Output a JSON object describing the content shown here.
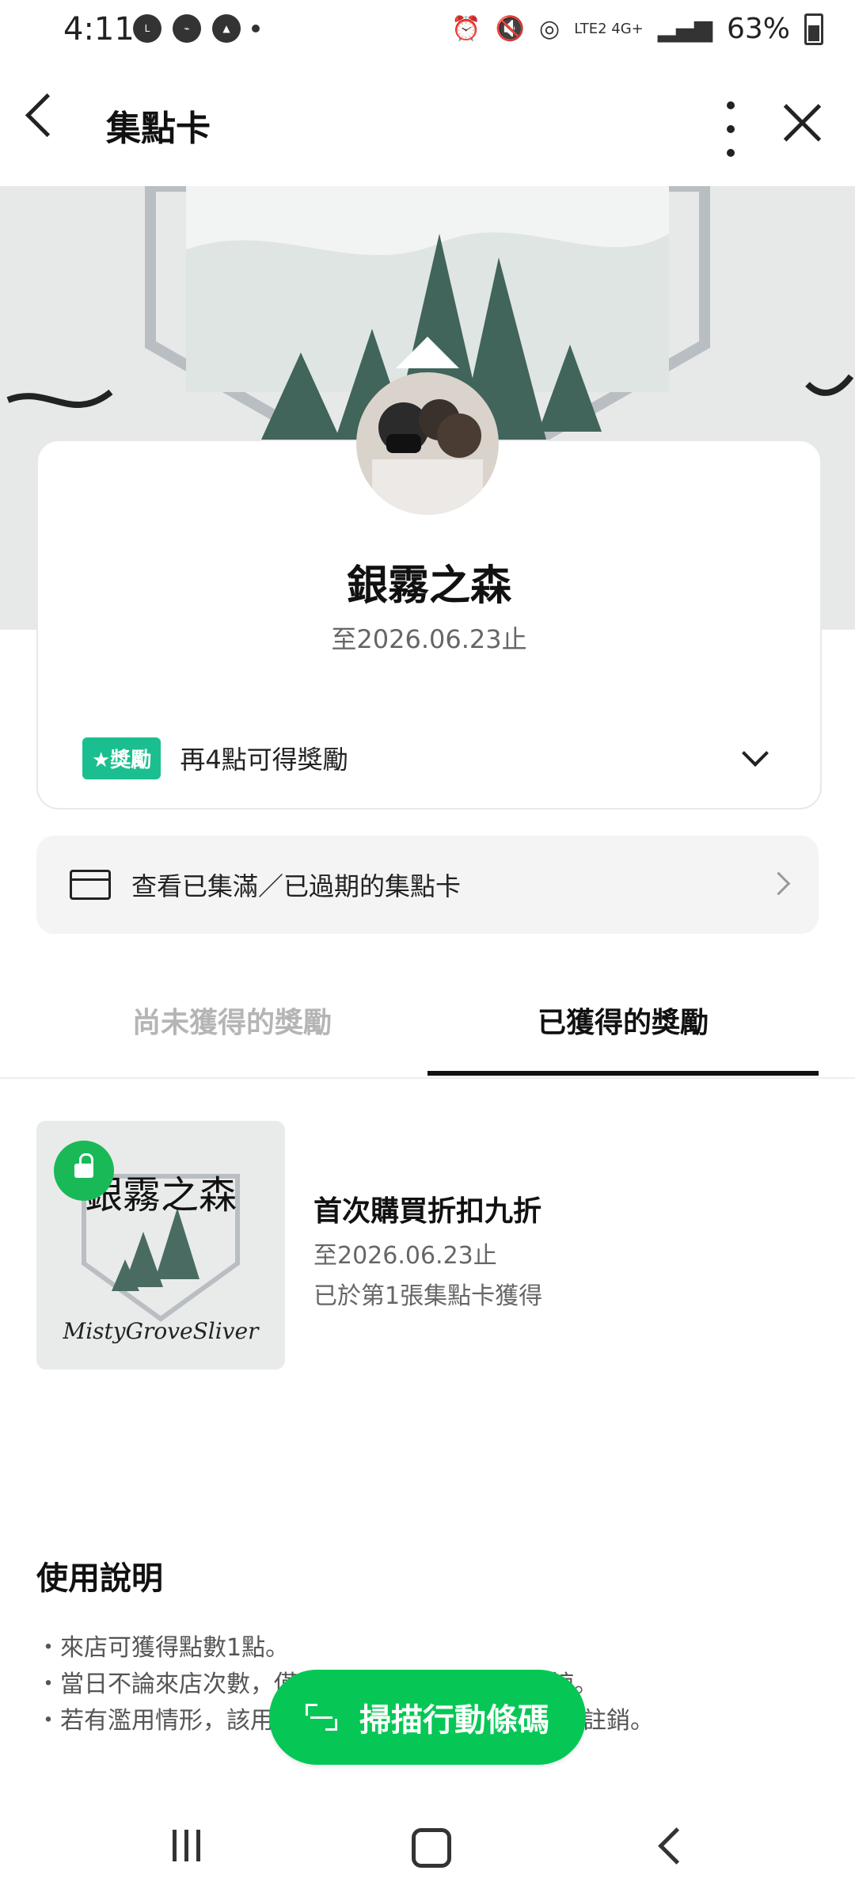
{
  "status_bar": {
    "time": "4:11",
    "battery": "63%",
    "network": "LTE2 4G+"
  },
  "header": {
    "title": "集點卡"
  },
  "card": {
    "shop_name": "銀霧之森",
    "expiry": "至2026.06.23止",
    "reward_badge": "★獎勵",
    "reward_progress": "再4點可得獎勵"
  },
  "past_cards_link": "查看已集滿／已過期的集點卡",
  "tabs": [
    {
      "label": "尚未獲得的獎勵",
      "active": false
    },
    {
      "label": "已獲得的獎勵",
      "active": true
    }
  ],
  "reward": {
    "thumbnail_title": "銀霧之森",
    "thumbnail_subtitle": "MistyGroveSliver",
    "title": "首次購買折扣九折",
    "expiry": "至2026.06.23止",
    "source": "已於第1張集點卡獲得"
  },
  "usage": {
    "title": "使用說明",
    "lines": [
      "・來店可獲得點數1點。",
      "・當日不論來店次數，僅能獲得點數1點，敬請見諒。",
      "・若有濫用情形，該用戶的集點卡等所有內容可能遭註銷。"
    ]
  },
  "scan_button": "掃描行動條碼",
  "colors": {
    "primary_green": "#06c755",
    "badge_green": "#1bbf8f"
  }
}
